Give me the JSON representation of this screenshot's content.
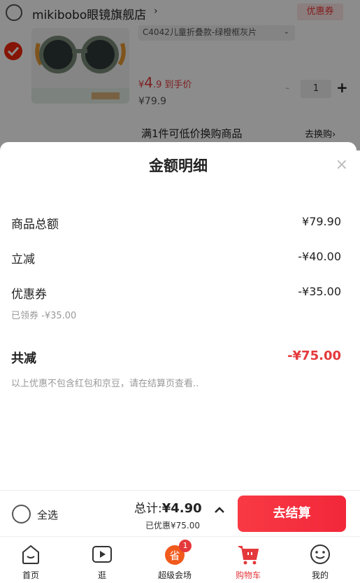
{
  "store": {
    "name": "mikibobo眼镜旗舰店",
    "arrow": "›",
    "coupon": "优惠券"
  },
  "item": {
    "variant": "C4042儿童折叠款-绿橙框灰片",
    "variant_caret": "⌄",
    "price_symbol": "¥",
    "price_int": "4",
    "price_dec": ".9",
    "price_note": "到手价",
    "orig_price": "¥79.9",
    "qty": "1",
    "qty_minus": "-",
    "qty_plus": "+",
    "promo": "满1件可低价换购商品",
    "promo_link": "去换购›"
  },
  "sheet": {
    "title": "金额明细",
    "close": "×",
    "rows": [
      {
        "label": "商品总额",
        "value": "¥79.90"
      },
      {
        "label": "立减",
        "value": "-¥40.00"
      },
      {
        "label": "优惠券",
        "value": "-¥35.00"
      }
    ],
    "coupon_sub": "已领券 -¥35.00",
    "total_label": "共减",
    "total_value": "-¥75.00",
    "note": "以上优惠不包含红包和京豆，请在结算页查看.."
  },
  "checkout": {
    "select_all": "全选",
    "sum_label": "总计:",
    "sum_value": "¥4.90",
    "discount": "已优惠¥75.00",
    "button": "去结算"
  },
  "tabs": [
    {
      "label": "首页",
      "icon": "home-icon"
    },
    {
      "label": "逛",
      "icon": "video-icon"
    },
    {
      "label": "超级会场",
      "icon": "super-venue-icon",
      "badge": "1"
    },
    {
      "label": "购物车",
      "icon": "cart-icon",
      "active": true
    },
    {
      "label": "我的",
      "icon": "profile-icon"
    }
  ],
  "colors": {
    "accent": "#e4393c",
    "button": "#f83a44"
  }
}
